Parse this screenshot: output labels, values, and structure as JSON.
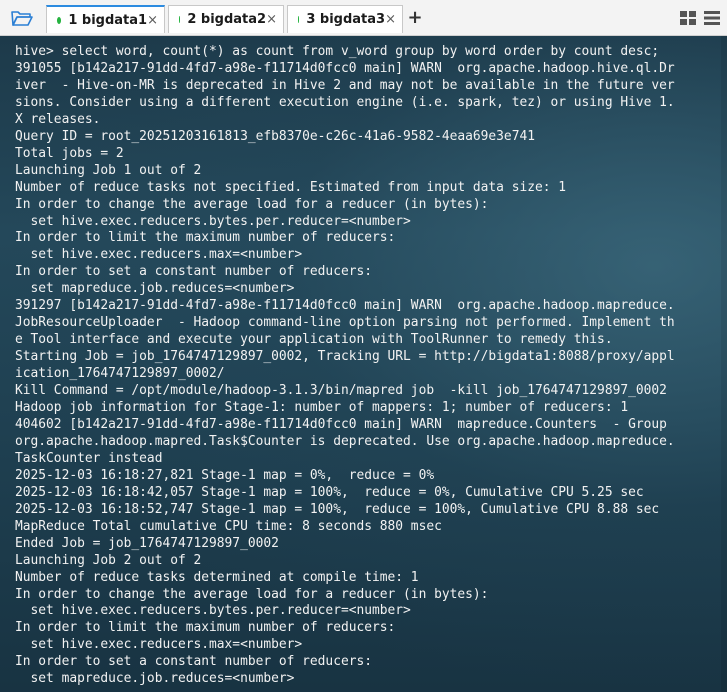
{
  "tabs": [
    {
      "label": "1 bigdata1",
      "close": "×"
    },
    {
      "label": "2 bigdata2",
      "close": "×"
    },
    {
      "label": "3 bigdata3",
      "close": "×"
    }
  ],
  "new_tab_label": "+",
  "status_color": "#26b340",
  "icons": {
    "folder": "folder-open-icon",
    "grid": "grid-view-icon",
    "menu": "menu-icon"
  },
  "terminal": {
    "lines": [
      "hive> select word, count(*) as count from v_word group by word order by count desc;",
      "391055 [b142a217-91dd-4fd7-a98e-f11714d0fcc0 main] WARN  org.apache.hadoop.hive.ql.Dr",
      "iver  - Hive-on-MR is deprecated in Hive 2 and may not be available in the future ver",
      "sions. Consider using a different execution engine (i.e. spark, tez) or using Hive 1.",
      "X releases.",
      "Query ID = root_20251203161813_efb8370e-c26c-41a6-9582-4eaa69e3e741",
      "Total jobs = 2",
      "Launching Job 1 out of 2",
      "Number of reduce tasks not specified. Estimated from input data size: 1",
      "In order to change the average load for a reducer (in bytes):",
      "  set hive.exec.reducers.bytes.per.reducer=<number>",
      "In order to limit the maximum number of reducers:",
      "  set hive.exec.reducers.max=<number>",
      "In order to set a constant number of reducers:",
      "  set mapreduce.job.reduces=<number>",
      "391297 [b142a217-91dd-4fd7-a98e-f11714d0fcc0 main] WARN  org.apache.hadoop.mapreduce.",
      "JobResourceUploader  - Hadoop command-line option parsing not performed. Implement th",
      "e Tool interface and execute your application with ToolRunner to remedy this.",
      "Starting Job = job_1764747129897_0002, Tracking URL = http://bigdata1:8088/proxy/appl",
      "ication_1764747129897_0002/",
      "Kill Command = /opt/module/hadoop-3.1.3/bin/mapred job  -kill job_1764747129897_0002",
      "Hadoop job information for Stage-1: number of mappers: 1; number of reducers: 1",
      "404602 [b142a217-91dd-4fd7-a98e-f11714d0fcc0 main] WARN  mapreduce.Counters  - Group",
      "org.apache.hadoop.mapred.Task$Counter is deprecated. Use org.apache.hadoop.mapreduce.",
      "TaskCounter instead",
      "2025-12-03 16:18:27,821 Stage-1 map = 0%,  reduce = 0%",
      "2025-12-03 16:18:42,057 Stage-1 map = 100%,  reduce = 0%, Cumulative CPU 5.25 sec",
      "2025-12-03 16:18:52,747 Stage-1 map = 100%,  reduce = 100%, Cumulative CPU 8.88 sec",
      "MapReduce Total cumulative CPU time: 8 seconds 880 msec",
      "Ended Job = job_1764747129897_0002",
      "Launching Job 2 out of 2",
      "Number of reduce tasks determined at compile time: 1",
      "In order to change the average load for a reducer (in bytes):",
      "  set hive.exec.reducers.bytes.per.reducer=<number>",
      "In order to limit the maximum number of reducers:",
      "  set hive.exec.reducers.max=<number>",
      "In order to set a constant number of reducers:",
      "  set mapreduce.job.reduces=<number>"
    ]
  }
}
